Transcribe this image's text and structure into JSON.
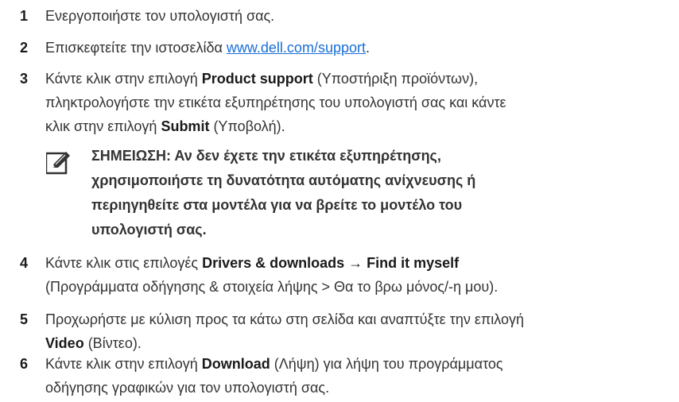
{
  "steps": [
    {
      "num": "1",
      "text": "Ενεργοποιήστε τον υπολογιστή σας."
    },
    {
      "num": "2",
      "prefix": "Επισκεφτείτε την ιστοσελίδα ",
      "link": "www.dell.com/support",
      "suffix": "."
    },
    {
      "num": "3",
      "line1_pre": "Κάντε κλικ στην επιλογή ",
      "line1_bold": "Product support",
      "line1_post": " (Υποστήριξη προϊόντων),",
      "line2": "πληκτρολογήστε την ετικέτα εξυπηρέτησης του υπολογιστή σας και κάντε",
      "line3_pre": "κλικ στην επιλογή ",
      "line3_bold": "Submit",
      "line3_post": " (Υποβολή)."
    },
    {
      "num": "4",
      "line1_pre": "Κάντε κλικ στις επιλογές ",
      "line1_bold": "Drivers & downloads → Find it myself",
      "line2": "(Προγράμματα οδήγησης & στοιχεία λήψης > Θα το βρω μόνος/-η μου)."
    },
    {
      "num": "5",
      "line1": "Προχωρήστε με κύλιση προς τα κάτω στη σελίδα και αναπτύξτε την επιλογή",
      "line2_bold": "Video",
      "line2_post": " (Βίντεο)."
    },
    {
      "num": "6",
      "line1_pre": "Κάντε κλικ στην επιλογή ",
      "line1_bold": "Download",
      "line1_post": " (Λήψη) για λήψη του προγράμματος",
      "line2": "οδήγησης γραφικών για τον υπολογιστή σας."
    }
  ],
  "note": {
    "icon": "pencil-note-icon",
    "lines": [
      "ΣΗΜΕΙΩΣΗ: Αν δεν έχετε την ετικέτα εξυπηρέτησης,",
      "χρησιμοποιήστε τη δυνατότητα αυτόματης ανίχνευσης ή",
      "περιηγηθείτε στα μοντέλα για να βρείτε το μοντέλο του",
      "υπολογιστή σας."
    ]
  },
  "colors": {
    "link": "#1a6fd6",
    "text": "#333333"
  }
}
